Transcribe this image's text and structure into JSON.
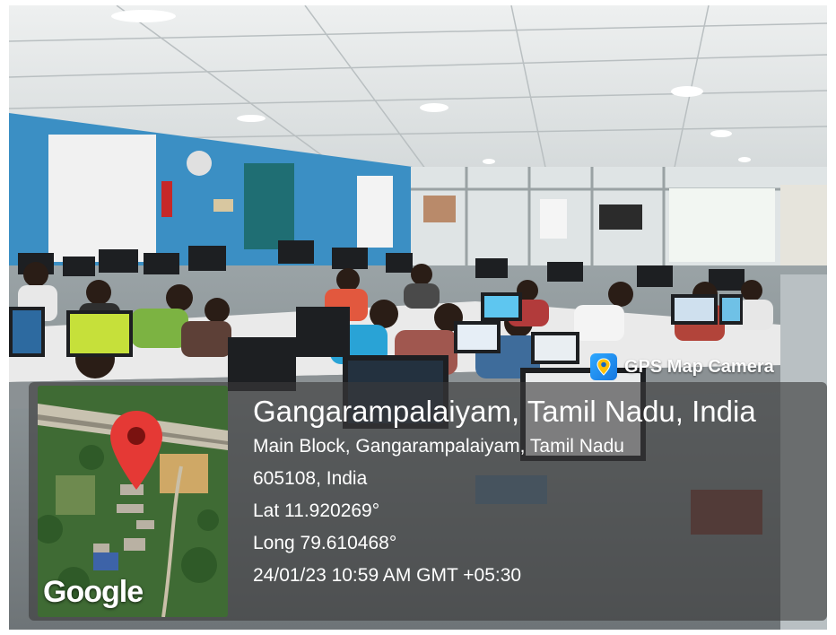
{
  "badge": {
    "label": "GPS Map Camera",
    "icon": "gps-map-camera-icon"
  },
  "location": {
    "title": "Gangarampalaiyam, Tamil Nadu, India",
    "address_line1": "Main Block, Gangarampalaiyam, Tamil Nadu",
    "address_line2": "605108, India",
    "latitude": "Lat 11.920269°",
    "longitude": "Long 79.610468°",
    "timestamp": "24/01/23 10:59 AM GMT +05:30"
  },
  "map": {
    "watermark": "Google",
    "marker_color": "#e53935"
  },
  "colors": {
    "wall": "#3b8fc4",
    "ceiling": "#e6e9ea",
    "overlay": "#3a3a3a"
  }
}
